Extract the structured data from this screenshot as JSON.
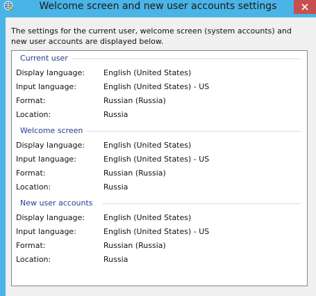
{
  "window": {
    "title": "Welcome screen and new user accounts settings"
  },
  "description": "The settings for the current user, welcome screen (system accounts) and new user accounts are displayed below.",
  "sections": [
    {
      "header": "Current user",
      "rows": [
        {
          "label": "Display language:",
          "value": "English (United States)"
        },
        {
          "label": "Input language:",
          "value": "English (United States) - US"
        },
        {
          "label": "Format:",
          "value": "Russian (Russia)"
        },
        {
          "label": "Location:",
          "value": "Russia"
        }
      ]
    },
    {
      "header": "Welcome screen",
      "rows": [
        {
          "label": "Display language:",
          "value": "English (United States)"
        },
        {
          "label": "Input language:",
          "value": "English (United States) - US"
        },
        {
          "label": "Format:",
          "value": "Russian (Russia)"
        },
        {
          "label": "Location:",
          "value": "Russia"
        }
      ]
    },
    {
      "header": "New user accounts",
      "rows": [
        {
          "label": "Display language:",
          "value": "English (United States)"
        },
        {
          "label": "Input language:",
          "value": "English (United States) - US"
        },
        {
          "label": "Format:",
          "value": "Russian (Russia)"
        },
        {
          "label": "Location:",
          "value": "Russia"
        }
      ]
    }
  ],
  "colors": {
    "frame": "#4ab4e6",
    "close_button": "#c7504f",
    "section_header": "#1f3f8f"
  },
  "icons": {
    "app": "globe-settings-icon",
    "close": "close-icon"
  }
}
